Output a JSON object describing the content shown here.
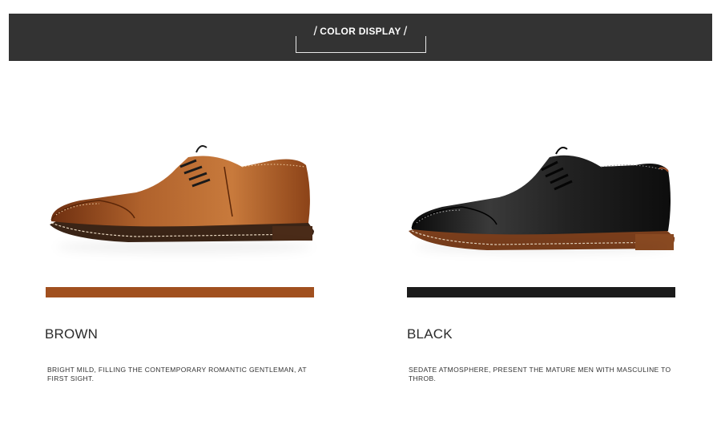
{
  "header": {
    "title": "COLOR DISPLAY"
  },
  "colors": [
    {
      "name": "BROWN",
      "swatch_color": "#a1501f",
      "description": "BRIGHT MILD, FILLING THE CONTEMPORARY ROMANTIC GENTLEMAN, AT FIRST SIGHT."
    },
    {
      "name": "BLACK",
      "swatch_color": "#1b1b1b",
      "description": "SEDATE ATMOSPHERE, PRESENT THE MATURE MEN WITH MASCULINE TO THROB."
    }
  ],
  "icons": {
    "brown_shoe": "brown-brogue-shoe-image",
    "black_shoe": "black-brogue-shoe-image"
  }
}
